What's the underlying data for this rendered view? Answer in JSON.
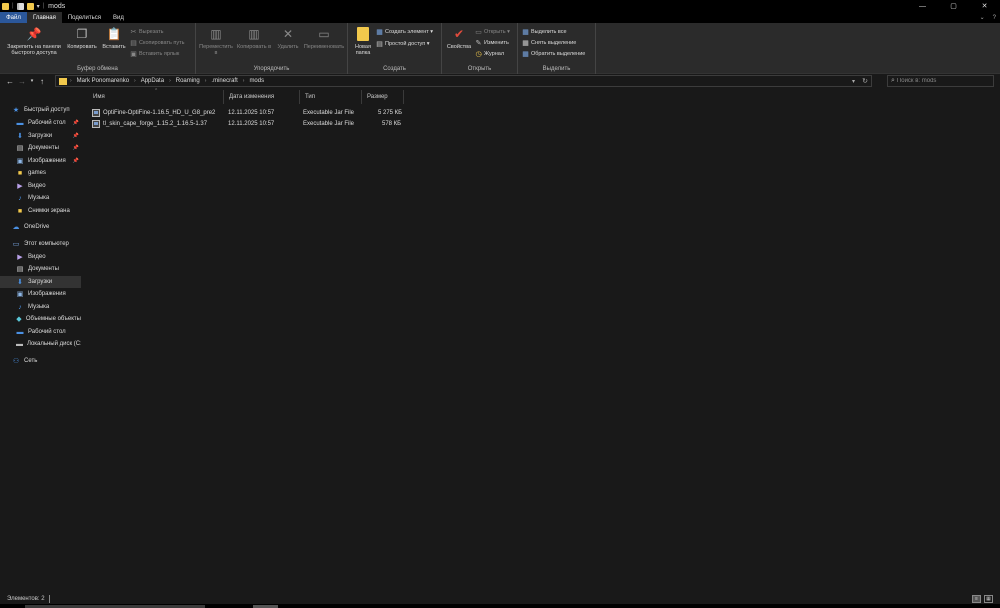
{
  "window": {
    "title": "mods",
    "controls": [
      "—",
      "▢",
      "✕"
    ]
  },
  "tabs": [
    "Файл",
    "Главная",
    "Поделиться",
    "Вид"
  ],
  "tabs_right": [
    "⌄",
    "?"
  ],
  "ribbon": {
    "clipboard": {
      "pin_label": "Закрепить на панели быстрого доступа",
      "copy_label": "Копировать",
      "paste_label": "Вставить",
      "cut_label": "Вырезать",
      "copy_path_label": "Скопировать путь",
      "paste_shortcut_label": "Вставить ярлык",
      "group_label": "Буфер обмена"
    },
    "organize": {
      "move_label": "Переместить в",
      "copy_to_label": "Копировать в",
      "delete_label": "Удалить",
      "rename_label": "Переименовать",
      "group_label": "Упорядочить"
    },
    "create": {
      "new_folder_label": "Новая папка",
      "new_item_label": "Создать элемент ▾",
      "easy_access_label": "Простой доступ ▾",
      "group_label": "Создать"
    },
    "open": {
      "properties_label": "Свойства",
      "open_label": "Открыть ▾",
      "edit_label": "Изменить",
      "history_label": "Журнал",
      "group_label": "Открыть"
    },
    "select": {
      "select_all_label": "Выделить все",
      "select_none_label": "Снять выделение",
      "invert_label": "Обратить выделение",
      "group_label": "Выделить"
    }
  },
  "address": {
    "breadcrumbs": [
      "Mark Ponomarenko",
      "AppData",
      "Roaming",
      ".minecraft",
      "mods"
    ],
    "search_placeholder": "Поиск в: mods"
  },
  "sidebar": {
    "items": [
      {
        "label": "Быстрый доступ",
        "icon": "star-icon",
        "pinned": false,
        "selected": false,
        "level": 0
      },
      {
        "label": "Рабочий стол",
        "icon": "desktop-icon",
        "pinned": true,
        "selected": false,
        "level": 1
      },
      {
        "label": "Загрузки",
        "icon": "download-icon",
        "pinned": true,
        "selected": false,
        "level": 1
      },
      {
        "label": "Документы",
        "icon": "document-icon",
        "pinned": true,
        "selected": false,
        "level": 1
      },
      {
        "label": "Изображения",
        "icon": "image-icon",
        "pinned": true,
        "selected": false,
        "level": 1
      },
      {
        "label": "games",
        "icon": "folder-icon",
        "pinned": false,
        "selected": false,
        "level": 1
      },
      {
        "label": "Видео",
        "icon": "video-icon",
        "pinned": false,
        "selected": false,
        "level": 1
      },
      {
        "label": "Музыка",
        "icon": "music-icon",
        "pinned": false,
        "selected": false,
        "level": 1
      },
      {
        "label": "Снимки экрана",
        "icon": "folder-icon",
        "pinned": false,
        "selected": false,
        "level": 1
      },
      {
        "label": "OneDrive",
        "icon": "cloud-icon",
        "pinned": false,
        "selected": false,
        "level": 0
      },
      {
        "label": "Этот компьютер",
        "icon": "computer-icon",
        "pinned": false,
        "selected": false,
        "level": 0
      },
      {
        "label": "Видео",
        "icon": "video-icon",
        "pinned": false,
        "selected": false,
        "level": 1
      },
      {
        "label": "Документы",
        "icon": "document-icon",
        "pinned": false,
        "selected": false,
        "level": 1
      },
      {
        "label": "Загрузки",
        "icon": "download-icon",
        "pinned": false,
        "selected": true,
        "level": 1
      },
      {
        "label": "Изображения",
        "icon": "image-icon",
        "pinned": false,
        "selected": false,
        "level": 1
      },
      {
        "label": "Музыка",
        "icon": "music-icon",
        "pinned": false,
        "selected": false,
        "level": 1
      },
      {
        "label": "Объемные объекты",
        "icon": "cube-icon",
        "pinned": false,
        "selected": false,
        "level": 1
      },
      {
        "label": "Рабочий стол",
        "icon": "desktop-icon",
        "pinned": false,
        "selected": false,
        "level": 1
      },
      {
        "label": "Локальный диск (C:)",
        "icon": "drive-icon",
        "pinned": false,
        "selected": false,
        "level": 1
      },
      {
        "label": "Сеть",
        "icon": "network-icon",
        "pinned": false,
        "selected": false,
        "level": 0
      }
    ]
  },
  "columns": [
    "Имя",
    "Дата изменения",
    "Тип",
    "Размер"
  ],
  "files": [
    {
      "name": "OptiFine-OptiFine-1.16.5_HD_U_G8_pre2",
      "date": "12.11.2025 10:57",
      "type": "Executable Jar File",
      "size": "5 275 КБ"
    },
    {
      "name": "tl_skin_cape_forge_1.15.2_1.16.5-1.37",
      "date": "12.11.2025 10:57",
      "type": "Executable Jar File",
      "size": "578 КБ"
    }
  ],
  "status": {
    "items_count": "Элементов: 2"
  },
  "colors": {
    "accent": "#2b579a",
    "background": "#191919",
    "ribbon": "#2b2b2b",
    "titlebar": "#000000",
    "folder": "#f2c94c"
  }
}
